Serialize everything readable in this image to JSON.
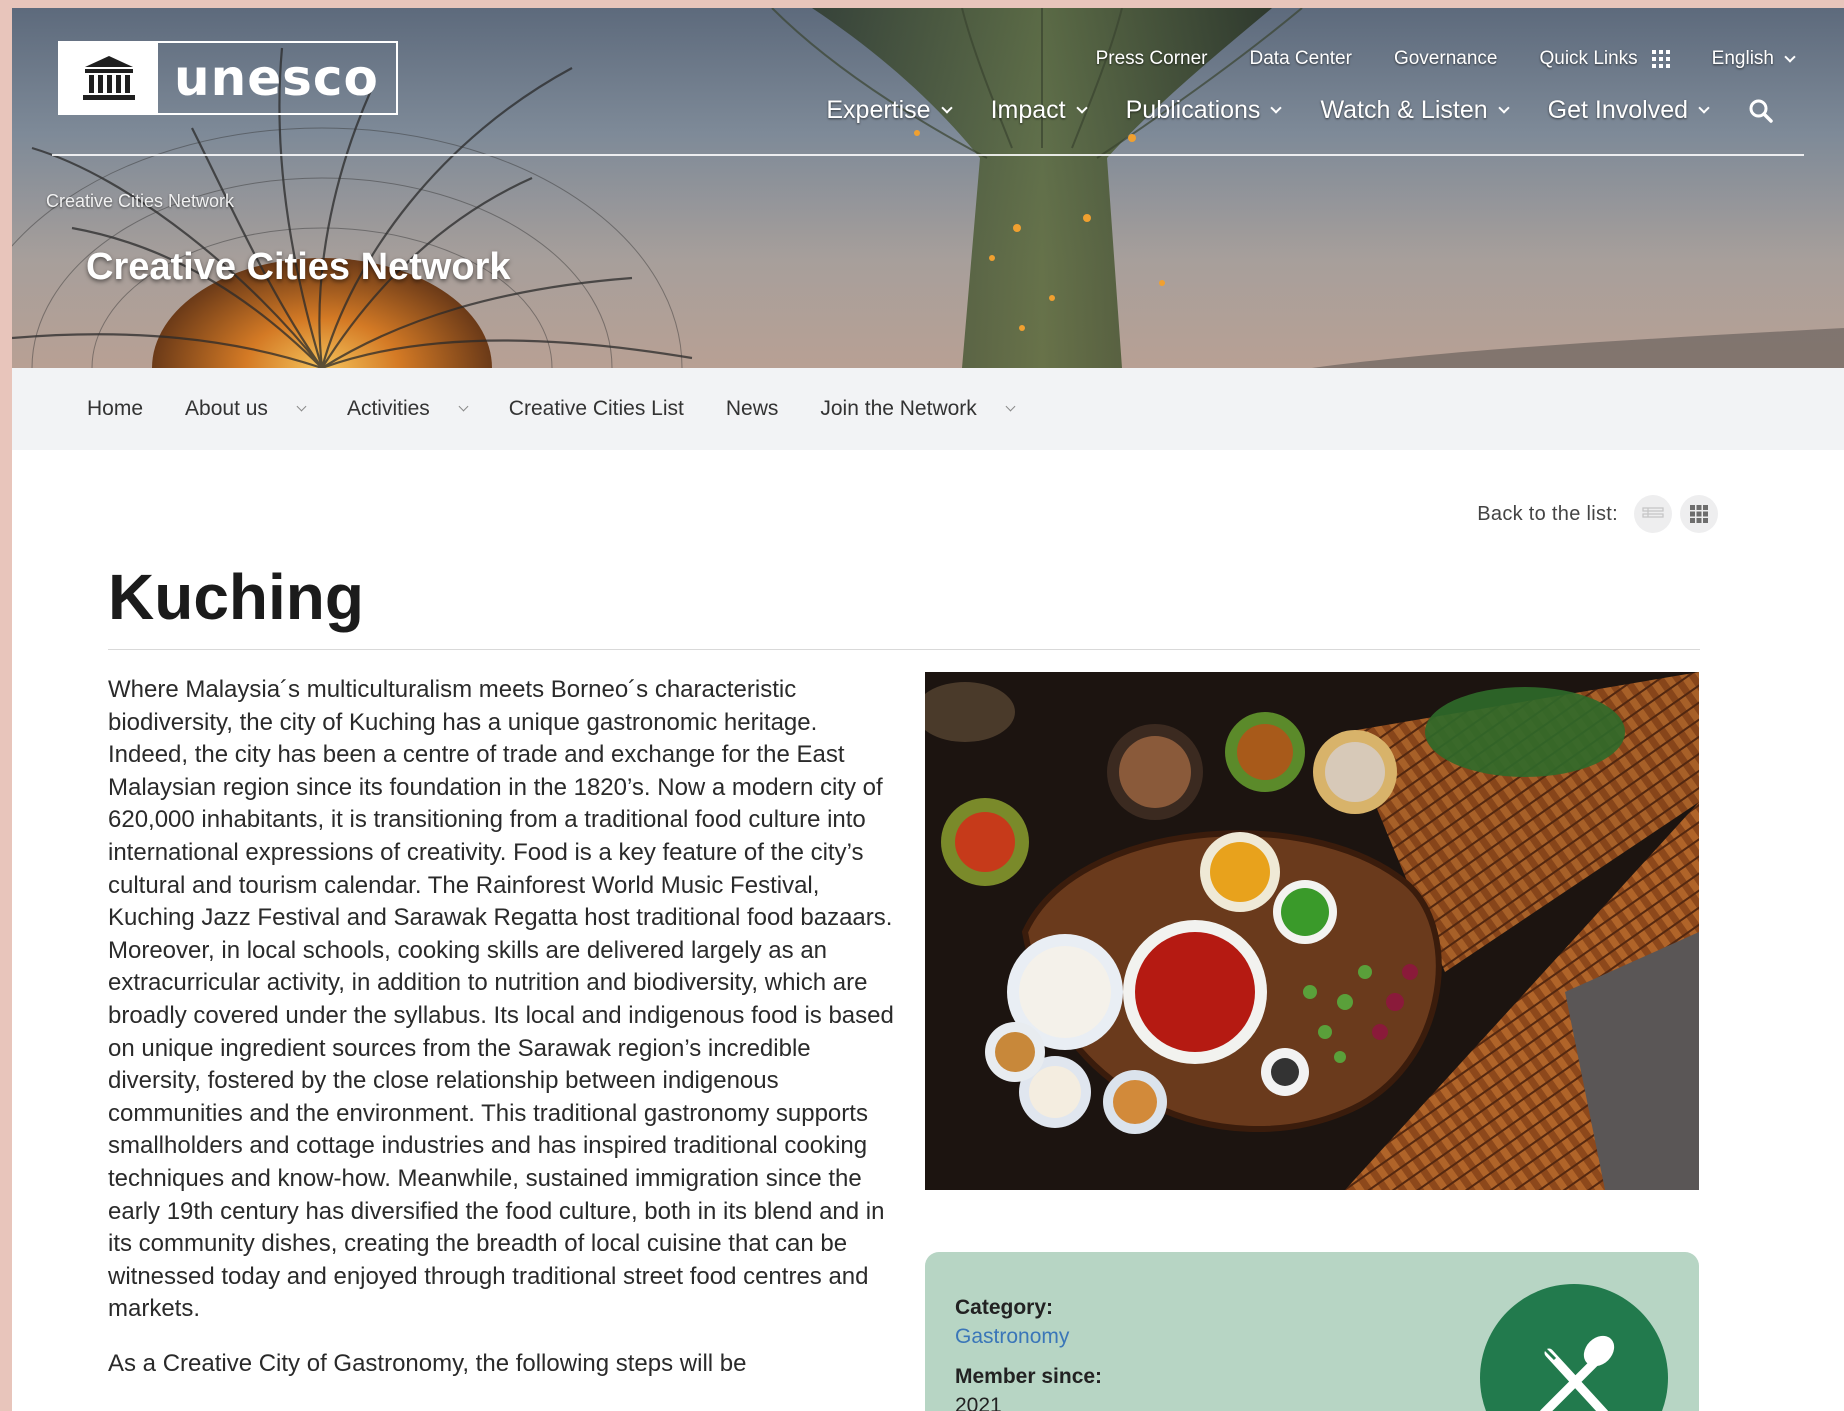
{
  "header": {
    "logo_text": "unesco",
    "utility_links": [
      "Press Corner",
      "Data Center",
      "Governance"
    ],
    "quick_links_label": "Quick Links",
    "language": "English",
    "main_nav": [
      "Expertise",
      "Impact",
      "Publications",
      "Watch & Listen",
      "Get Involved"
    ],
    "breadcrumb": "Creative Cities Network",
    "hero_title": "Creative Cities Network"
  },
  "subnav": {
    "items": [
      {
        "label": "Home",
        "dropdown": false
      },
      {
        "label": "About us",
        "dropdown": true
      },
      {
        "label": "Activities",
        "dropdown": true
      },
      {
        "label": "Creative Cities List",
        "dropdown": false
      },
      {
        "label": "News",
        "dropdown": false
      },
      {
        "label": "Join the Network",
        "dropdown": true
      }
    ]
  },
  "back": {
    "label": "Back to the list:"
  },
  "main": {
    "title": "Kuching",
    "paragraphs": [
      "Where Malaysia´s multiculturalism meets Borneo´s characteristic biodiversity, the city of Kuching has a unique gastronomic heritage. Indeed, the city has been a centre of trade and exchange for the East Malaysian region since its foundation in the 1820’s. Now a modern city of 620,000 inhabitants, it is transitioning from a traditional food culture into international expressions of creativity. Food is a key feature of the city’s cultural and tourism calendar. The Rainforest World Music Festival, Kuching Jazz Festival and Sarawak Regatta host traditional food bazaars. Moreover, in local schools, cooking skills are delivered largely as an extracurricular activity, in addition to nutrition and biodiversity, which are broadly covered under the syllabus. Its local and indigenous food is based on unique ingredient sources from the Sarawak region’s incredible diversity, fostered by the close relationship between indigenous communities and the environment. This traditional gastronomy supports smallholders and cottage industries and has inspired traditional cooking techniques and know-how. Meanwhile, sustained immigration since the early 19th century has diversified the food culture, both in its blend and in its community dishes, creating the breadth of local cuisine that can be witnessed today and enjoyed through traditional street food centres and markets.",
      "As a Creative City of Gastronomy, the following steps will be"
    ]
  },
  "info": {
    "category_label": "Category:",
    "category_value": "Gastronomy",
    "member_label": "Member since:",
    "member_value": "2021",
    "badge_icon": "fork-spoon-icon"
  },
  "colors": {
    "badge": "#227a4d",
    "info_bg": "#b7d5c4",
    "link": "#3a76b8",
    "subnav_bg": "#f2f3f5"
  }
}
